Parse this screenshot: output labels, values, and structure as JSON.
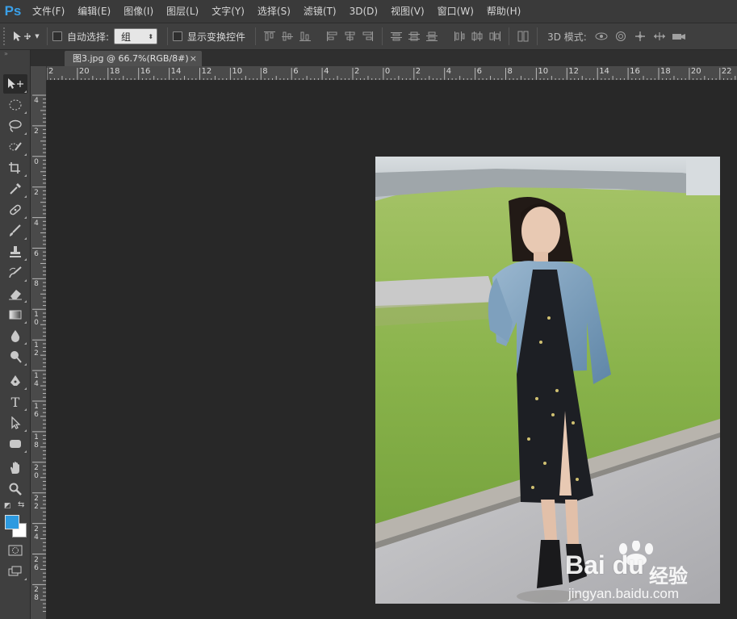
{
  "app": {
    "logo": "Ps"
  },
  "menu": [
    {
      "label": "文件(F)"
    },
    {
      "label": "编辑(E)"
    },
    {
      "label": "图像(I)"
    },
    {
      "label": "图层(L)"
    },
    {
      "label": "文字(Y)"
    },
    {
      "label": "选择(S)"
    },
    {
      "label": "滤镜(T)"
    },
    {
      "label": "3D(D)"
    },
    {
      "label": "视图(V)"
    },
    {
      "label": "窗口(W)"
    },
    {
      "label": "帮助(H)"
    }
  ],
  "options": {
    "tool_preset_icon": "move-tool-icon",
    "auto_select_label": "自动选择:",
    "auto_select_checked": false,
    "auto_select_value": "组",
    "show_transform_label": "显示变换控件",
    "show_transform_checked": false,
    "mode3d_label": "3D 模式:"
  },
  "document": {
    "tab_title": "图3.jpg @ 66.7%(RGB/8#)",
    "close_glyph": "×"
  },
  "ruler_top": [
    "2",
    "20",
    "18",
    "16",
    "14",
    "12",
    "10",
    "8",
    "6",
    "4",
    "2",
    "0",
    "2",
    "4",
    "6",
    "8",
    "10",
    "12",
    "14",
    "16",
    "18",
    "20",
    "22"
  ],
  "ruler_left": [
    "4",
    "2",
    "0",
    "2",
    "4",
    "6",
    "8",
    "10",
    "12",
    "14",
    "16",
    "18",
    "20",
    "22",
    "24",
    "26",
    "28"
  ],
  "colors": {
    "foreground": "#2d9ae0",
    "background": "#ffffff",
    "accent": "#3aa0e8"
  },
  "watermark": {
    "logo": "Bai du",
    "cn": "经验",
    "url": "jingyan.baidu.com"
  }
}
